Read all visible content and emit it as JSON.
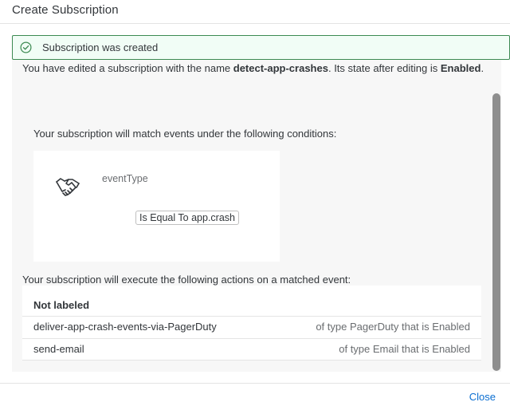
{
  "dialog": {
    "title": "Create Subscription",
    "close_label": "Close"
  },
  "message_strip": {
    "type": "success",
    "icon": "check-circle-icon",
    "text": "Subscription was created",
    "accent_color": "#3c8a52"
  },
  "summary": {
    "prefix": "You have edited a subscription with the name ",
    "name": "detect-app-crashes",
    "middle": ". Its state after editing is ",
    "state": "Enabled",
    "suffix": "."
  },
  "conditions": {
    "intro": "Your subscription will match events under the following conditions:",
    "icon": "handshake-icon",
    "field": "eventType",
    "operator_expression": "Is Equal To app.crash"
  },
  "actions": {
    "intro": "Your subscription will execute the following actions on a matched event:",
    "group_label": "Not labeled",
    "rows": [
      {
        "name": "deliver-app-crash-events-via-PagerDuty",
        "type": "of type PagerDuty that is Enabled"
      },
      {
        "name": "send-email",
        "type": "of type Email that is Enabled"
      }
    ]
  },
  "colors": {
    "link": "#0a6ed1",
    "content_bg": "#f7f7f7"
  }
}
